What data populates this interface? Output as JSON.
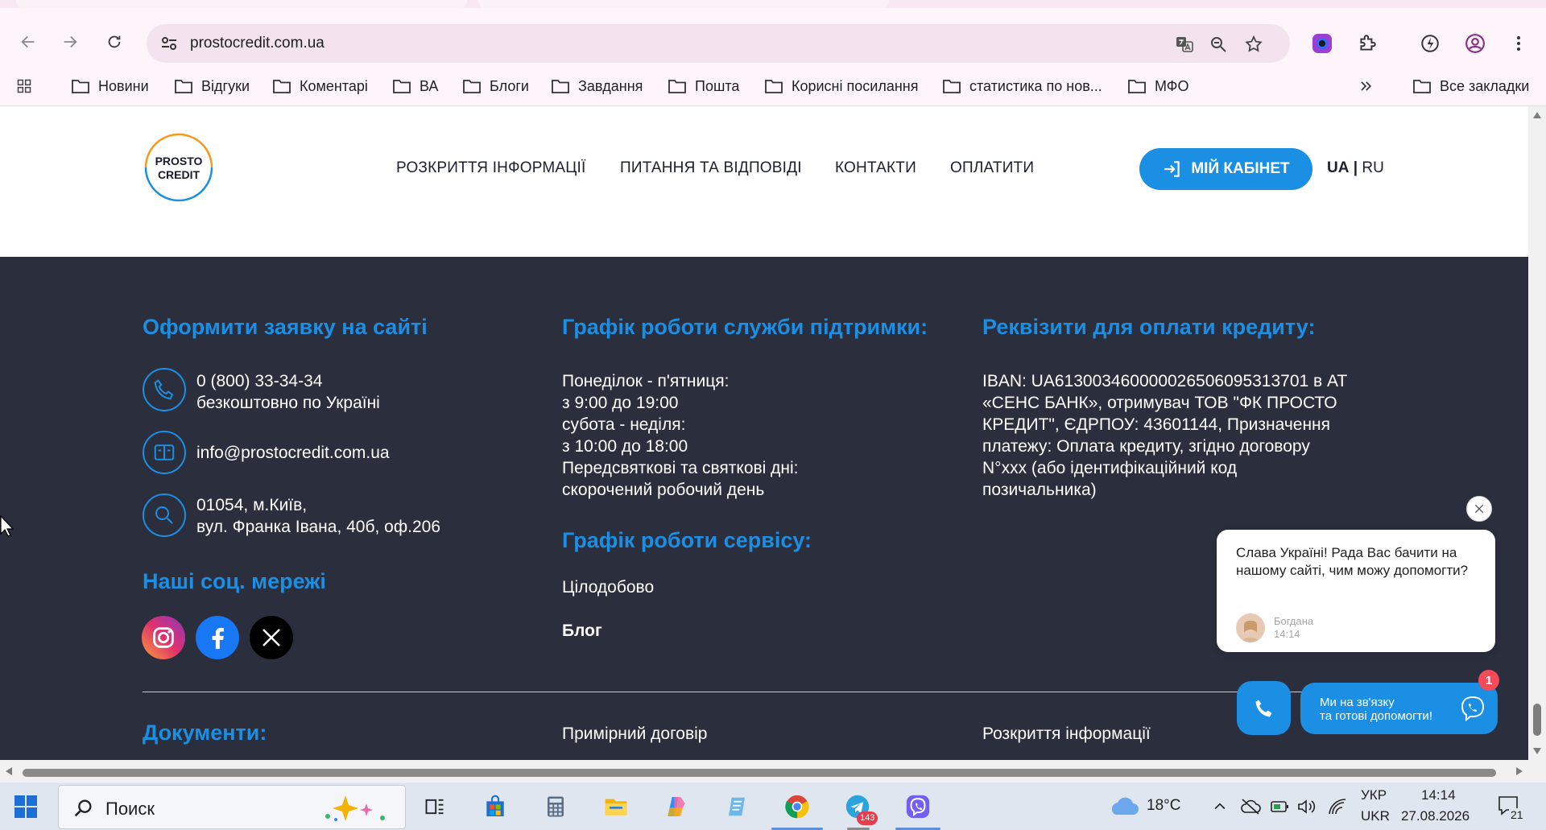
{
  "browser": {
    "url": "prostocredit.com.ua",
    "bookmarks": [
      "Новини",
      "Відгуки",
      "Коментарі",
      "ВА",
      "Блоги",
      "Завдання",
      "Пошта",
      "Корисні посилання",
      "статистика по нов...",
      "МФО"
    ],
    "all_bookmarks": "Все закладки"
  },
  "header": {
    "logo": {
      "line1": "PROSTO",
      "line2": "CREDIT"
    },
    "menu": [
      "РОЗКРИТТЯ ІНФОРМАЦІЇ",
      "ПИТАННЯ ТА ВІДПОВІДІ",
      "КОНТАКТИ",
      "ОПЛАТИТИ"
    ],
    "cabinet_label": "МІЙ КАБІНЕТ",
    "lang_active": "UA",
    "lang_sep": "|",
    "lang_other": "RU"
  },
  "footer": {
    "col1": {
      "heading": "Оформити заявку на сайті",
      "phone": "0 (800) 33-34-34",
      "phone_note": "безкоштовно по Україні",
      "email": "info@prostocredit.com.ua",
      "address_line1": "01054, м.Київ,",
      "address_line2": "вул. Франка Івана, 40б, оф.206",
      "social_heading": "Наші соц. мережі"
    },
    "col2": {
      "heading": "Графік роботи служби підтримки:",
      "schedule": [
        "Понеділок - п'ятниця:",
        "з 9:00 до 19:00",
        "субота - неділя:",
        "з 10:00 до 18:00",
        "Передсвяткові та святкові дні:",
        "скорочений робочий день"
      ],
      "service_heading": "Графік роботи сервісу:",
      "service_text": "Цілодобово",
      "blog": "Блог"
    },
    "col3": {
      "heading": "Реквізити для оплати кредиту:",
      "requisites": [
        "IBAN: UA613003460000026506095313701 в АТ",
        "«СЕНС БАНК», отримувач ТОВ \"ФК ПРОСТО",
        "КРЕДИТ\", ЄДРПОУ: 43601144, Призначення",
        "платежу: Оплата кредиту, згідно договору",
        "N°xxx (або ідентифікаційний код",
        "позичальника)"
      ]
    },
    "documents_heading": "Документи:",
    "doc_link1": "Примірний договір",
    "doc_link2": "Розкриття інформації"
  },
  "chat": {
    "message": "Слава Україні! Рада Вас бачити на нашому сайті, чим можу допомогти?",
    "agent": "Богдана",
    "time": "14:14",
    "viber_line1": "Ми на зв'язку",
    "viber_line2": "та готові допомогти!",
    "badge": "1"
  },
  "taskbar": {
    "search": "Поиск",
    "telegram_badge": "143",
    "temperature": "18°C",
    "lang1": "УКР",
    "lang2": "UKR",
    "time": "14:14",
    "date": "27.08.2026",
    "notifications": "21"
  },
  "colors": {
    "accent": "#1a8fe3",
    "footer_bg": "#2b2e3c"
  }
}
